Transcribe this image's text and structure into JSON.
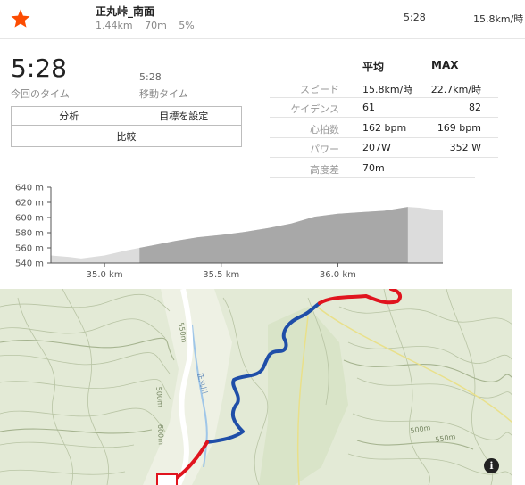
{
  "segment": {
    "name": "正丸峠_南面",
    "distance": "1.44km",
    "elevation_gain": "70m",
    "grade": "5%",
    "time": "5:28",
    "speed": "15.8km/時"
  },
  "summary": {
    "elapsed_time": "5:28",
    "elapsed_label": "今回のタイム",
    "moving_time": "5:28",
    "moving_label": "移動タイム"
  },
  "buttons": {
    "analysis": "分析",
    "set_goal": "目標を設定",
    "compare": "比較"
  },
  "stats": {
    "header_avg": "平均",
    "header_max": "MAX",
    "rows": [
      {
        "label": "スピード",
        "avg": "15.8km/時",
        "max": "22.7km/時"
      },
      {
        "label": "ケイデンス",
        "avg": "61",
        "max": "82"
      },
      {
        "label": "心拍数",
        "avg": "162 bpm",
        "max": "169 bpm"
      },
      {
        "label": "パワー",
        "avg": "207W",
        "max": "352 W"
      },
      {
        "label": "高度差",
        "avg": "70m",
        "max": ""
      }
    ]
  },
  "chart_data": {
    "type": "area",
    "ylim": [
      540,
      640
    ],
    "yticks": [
      "640 m",
      "620 m",
      "600 m",
      "580 m",
      "560 m",
      "540 m"
    ],
    "xticks": [
      "35.0 km",
      "35.5 km",
      "36.0 km"
    ],
    "xtick_values": [
      35.0,
      35.5,
      36.0
    ],
    "segment_range_km": [
      35.15,
      36.3
    ],
    "x": [
      34.77,
      34.85,
      34.9,
      35.0,
      35.1,
      35.2,
      35.3,
      35.4,
      35.5,
      35.6,
      35.7,
      35.8,
      35.9,
      36.0,
      36.05,
      36.1,
      36.2,
      36.3,
      36.35,
      36.45
    ],
    "y": [
      550,
      548,
      546,
      550,
      557,
      563,
      569,
      574,
      577,
      581,
      586,
      592,
      601,
      605,
      606,
      607,
      609,
      614,
      613,
      609
    ],
    "colors": {
      "segment": "#a8a8a8",
      "outside": "#dcdcdc",
      "axis": "#555555"
    }
  },
  "map": {
    "labels": [
      "550m",
      "500m",
      "正丸川",
      "600m",
      "500m",
      "550m"
    ],
    "route_color": "#1f4ea8",
    "route_outside_color": "#e0141e",
    "info_glyph": "i"
  }
}
